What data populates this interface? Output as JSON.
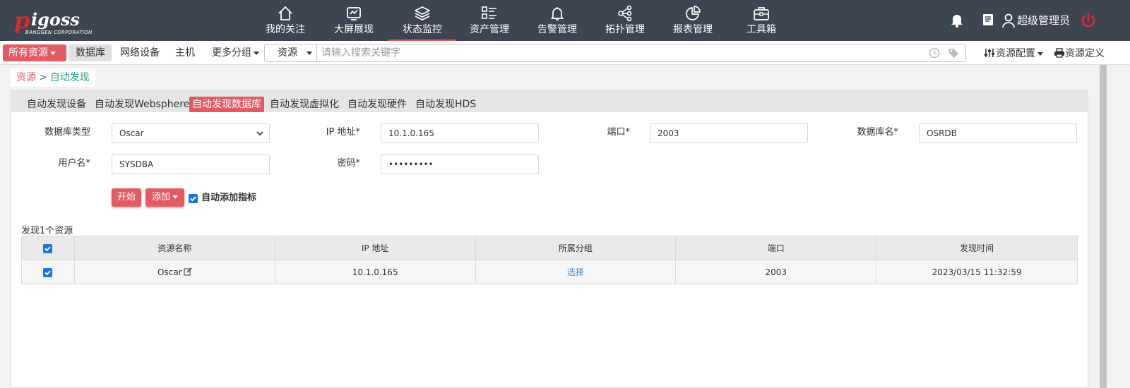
{
  "logo": {
    "text": "igoss",
    "mark": "p",
    "tagline": "BANGGEN CORPORATION",
    "trademark": "®"
  },
  "nav": [
    {
      "label": "我的关注",
      "icon": "home-icon"
    },
    {
      "label": "大屏展现",
      "icon": "screen-icon"
    },
    {
      "label": "状态监控",
      "icon": "layers-icon",
      "active": true
    },
    {
      "label": "资产管理",
      "icon": "list-icon"
    },
    {
      "label": "告警管理",
      "icon": "bell-icon"
    },
    {
      "label": "拓扑管理",
      "icon": "topology-icon"
    },
    {
      "label": "报表管理",
      "icon": "pie-chart-icon"
    },
    {
      "label": "工具箱",
      "icon": "toolbox-icon"
    }
  ],
  "user": {
    "name": "超级管理员"
  },
  "subbar": {
    "all_resources": "所有资源",
    "database": "数据库",
    "network": "网络设备",
    "host": "主机",
    "more_groups": "更多分组",
    "search_scope": "资源",
    "search_placeholder": "请输入搜索关键字",
    "resource_config": "资源配置",
    "resource_define": "资源定义"
  },
  "breadcrumb": {
    "root": "资源",
    "sep": ">",
    "current": "自动发现"
  },
  "tabs": [
    {
      "label": "自动发现设备"
    },
    {
      "label": "自动发现Websphere"
    },
    {
      "label": "自动发现数据库",
      "active": true
    },
    {
      "label": "自动发现虚拟化"
    },
    {
      "label": "自动发现硬件"
    },
    {
      "label": "自动发现HDS"
    }
  ],
  "form": {
    "db_type_label": "数据库类型",
    "db_type_value": "Oscar",
    "ip_label": "IP 地址*",
    "ip_value": "10.1.0.165",
    "port_label": "端口*",
    "port_value": "2003",
    "db_name_label": "数据库名*",
    "db_name_value": "OSRDB",
    "user_label": "用户名*",
    "user_value": "SYSDBA",
    "password_label": "密码*",
    "password_value": "•••••••••"
  },
  "actions": {
    "start": "开始",
    "add": "添加",
    "auto_add": "自动添加指标",
    "auto_add_checked": true
  },
  "results": {
    "summary": "发现1个资源",
    "columns": [
      "资源名称",
      "IP 地址",
      "所属分组",
      "端口",
      "发现时间"
    ],
    "rows": [
      {
        "name": "Oscar",
        "ip": "10.1.0.165",
        "group": "选择",
        "port": "2003",
        "time": "2023/03/15 11:32:59",
        "checked": true
      }
    ]
  },
  "colors": {
    "topbar": "#3d4452",
    "accent": "#e35a63",
    "link": "#3a86d9",
    "crumb_current": "#2aa08a"
  }
}
